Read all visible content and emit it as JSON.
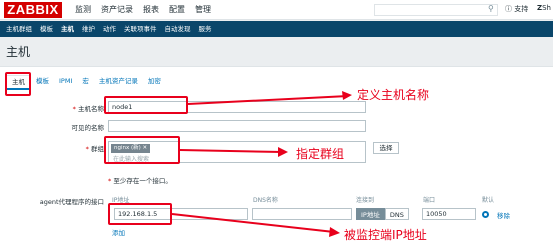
{
  "header": {
    "logo": "ZABBIX",
    "menu": [
      "监测",
      "资产记录",
      "报表",
      "配置",
      "管理"
    ],
    "active_menu": "配置",
    "support_label": "支持",
    "share_label": "Sh"
  },
  "submenu": {
    "items": [
      "主机群组",
      "模板",
      "主机",
      "维护",
      "动作",
      "关联项事件",
      "自动发现",
      "服务"
    ],
    "active": "主机"
  },
  "page_title": "主机",
  "tabs": [
    "主机",
    "模板",
    "IPMI",
    "宏",
    "主机资产记录",
    "加密"
  ],
  "form": {
    "hostname_label": "主机名称",
    "hostname_value": "node1",
    "visible_name_label": "可见的名称",
    "visible_name_value": "",
    "groups_label": "群组",
    "group_tag": "nginx (新) ✕",
    "group_search_placeholder": "在此输入搜索",
    "select_button": "选择",
    "interface_hint": "至少存在一个接口。",
    "agent_label": "agent代理程序的接口",
    "interface_columns": [
      "IP地址",
      "DNS名称",
      "连接到",
      "端口",
      "默认"
    ],
    "ip_value": "192.168.1.5",
    "dns_value": "",
    "connect_ip": "IP地址",
    "connect_dns": "DNS",
    "port_value": "10050",
    "remove_label": "移除",
    "add_label": "添加",
    "required_mark": "*"
  },
  "annotations": {
    "hostname": "定义主机名称",
    "group": "指定群组",
    "ip": "被监控端IP地址",
    "color": "#e8001c"
  }
}
